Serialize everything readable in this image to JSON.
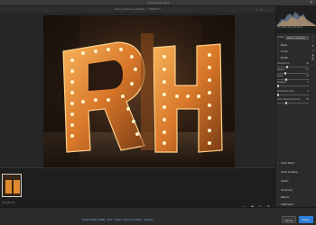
{
  "window": {
    "title": "Camera Raw 15.3",
    "close_icon": "✕"
  },
  "toolbar": {
    "filename": "Neon_Nocturne_R-Whig  —  RGB 8 bit",
    "tools": "⌖ ▦ ◐ ⋯"
  },
  "photo": {
    "letters": [
      "R",
      "H"
    ],
    "brand_color": "#f29a2e"
  },
  "filmstrip": {
    "zoom": "Fit (18.1%)",
    "views": "▭ ▣ ◫ ⚙"
  },
  "statusbar": {
    "info": "Adobe RGB (1998) - 8 bit - 6012 x 4016 (24.1MP) - 240 ppi",
    "cancel": "Cancel",
    "done": "Done"
  },
  "panel": {
    "readout": "f/8  1/100s  ISO 100  24mm",
    "profile_label": "Profile",
    "profile_value": "Adobe Landscape",
    "sections": {
      "basic": "Basic",
      "curve": "Curve",
      "detail": "Detail",
      "color_mixer": "Color Mixer",
      "color_grading": "Color Grading",
      "optics": "Optics",
      "geometry": "Geometry",
      "effects": "Effects",
      "calibration": "Calibration"
    },
    "rows": {
      "sharpening": {
        "label": "Sharpening",
        "value": "40"
      },
      "radius": {
        "label": "Radius",
        "value": "1.0"
      },
      "detail": {
        "label": "Detail",
        "value": "25"
      },
      "masking": {
        "label": "Masking",
        "value": "0"
      },
      "noise": {
        "label": "Noise Reduction",
        "value": "0"
      },
      "color_noise": {
        "label": "Color Noise Reduction",
        "value": "25"
      }
    }
  }
}
